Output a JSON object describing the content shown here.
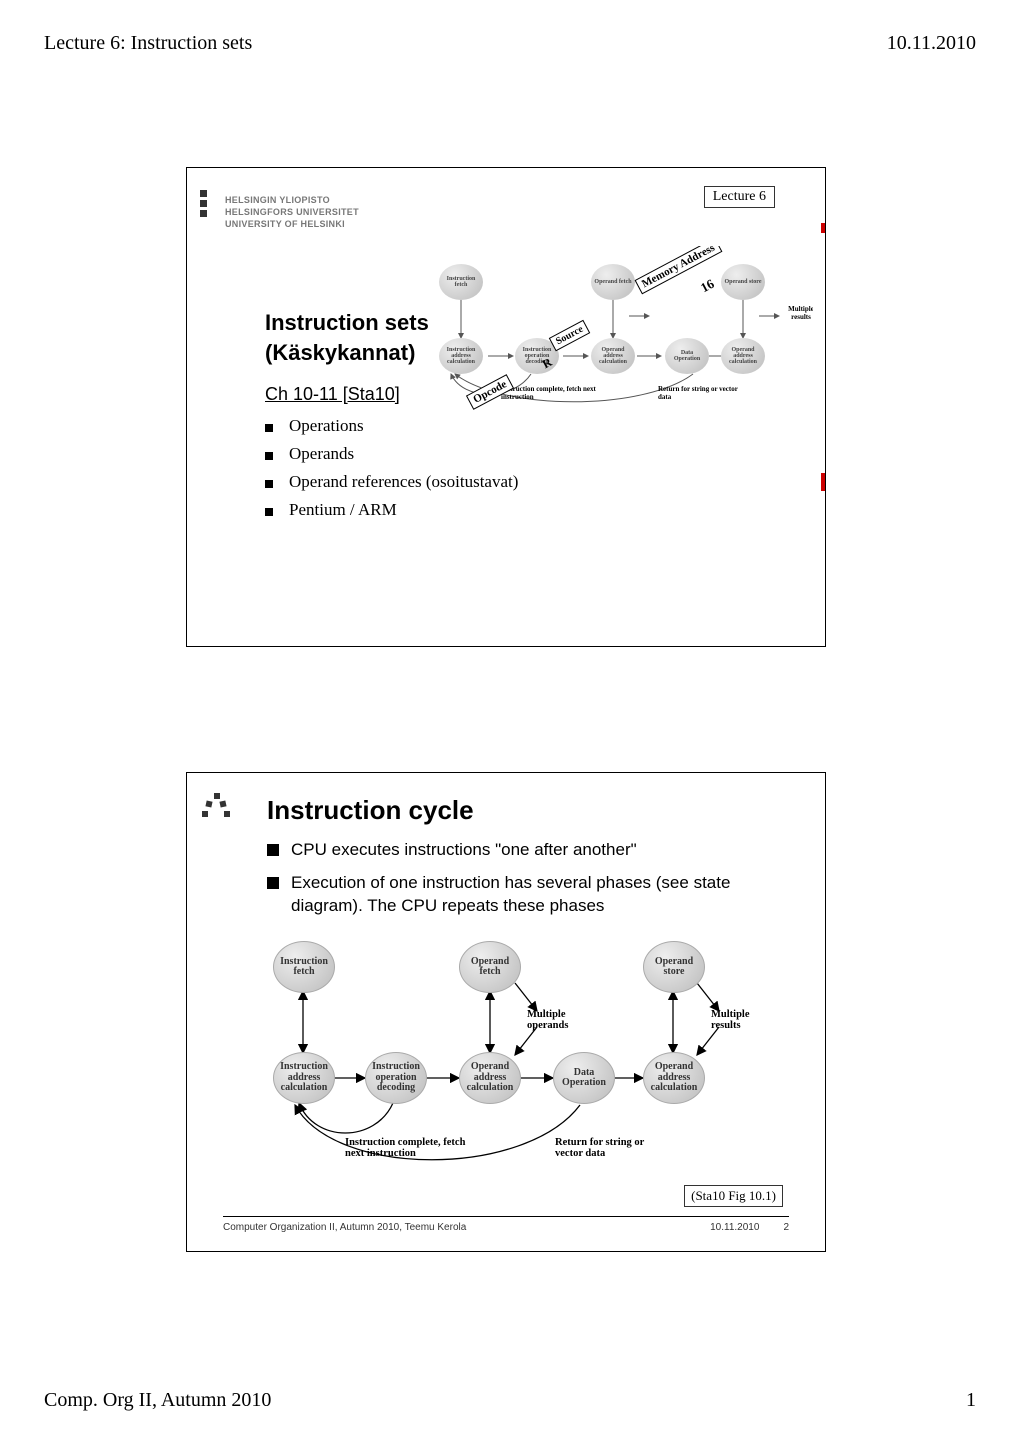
{
  "page": {
    "header_left": "Lecture 6: Instruction sets",
    "header_right": "10.11.2010",
    "footer_left": "Comp. Org II, Autumn 2010",
    "footer_right": "1"
  },
  "slide1": {
    "lecture_badge": "Lecture 6",
    "university": {
      "line1": "HELSINGIN YLIOPISTO",
      "line2": "HELSINGFORS UNIVERSITET",
      "line3": "UNIVERSITY OF HELSINKI"
    },
    "title_line1": "Instruction sets",
    "title_line2": "(Käskykannat)",
    "chapter": "Ch 10-11 [Sta10]",
    "items": [
      "Operations",
      "Operands",
      "Operand references (osoitustavat)",
      "Pentium / ARM"
    ],
    "overlay_labels": {
      "memory_address": "Memory Address",
      "sixteen": "16",
      "source": "Source",
      "r": "R",
      "opcode": "Opcode"
    },
    "diagram_nodes": {
      "instruction_fetch": "Instruction fetch",
      "operand_fetch": "Operand fetch",
      "operand_store": "Operand store",
      "multiple_results": "Multiple results",
      "instruction_address_calc": "Instruction address calculation",
      "instruction_op_decode": "Instruction operation decoding",
      "operand_address_calc_src": "Operand address calculation",
      "data_operation": "Data Operation",
      "operand_address_calc_dst": "Operand address calculation",
      "instruction_complete": "Instruction complete, fetch next instruction",
      "return_string": "Return for string or vector data"
    }
  },
  "slide2": {
    "title": "Instruction cycle",
    "bullets": [
      "CPU executes instructions \"one after another\"",
      "Execution of one instruction has several phases (see state diagram). The CPU repeats these phases"
    ],
    "diagram": {
      "nodes": {
        "instruction_fetch": {
          "l1": "Instruction",
          "l2": "fetch"
        },
        "operand_fetch": {
          "l1": "Operand",
          "l2": "fetch"
        },
        "operand_store": {
          "l1": "Operand",
          "l2": "store"
        },
        "instruction_address_calc": {
          "l1": "Instruction",
          "l2": "address",
          "l3": "calculation"
        },
        "instruction_op_decoding": {
          "l1": "Instruction",
          "l2": "operation",
          "l3": "decoding"
        },
        "operand_address_calc_src": {
          "l1": "Operand",
          "l2": "address",
          "l3": "calculation"
        },
        "data_operation": {
          "l1": "Data",
          "l2": "Operation"
        },
        "operand_address_calc_dst": {
          "l1": "Operand",
          "l2": "address",
          "l3": "calculation"
        }
      },
      "labels": {
        "multiple_operands": "Multiple operands",
        "multiple_results": "Multiple results",
        "instruction_complete": "Instruction complete, fetch next instruction",
        "return_string": "Return for string or vector data"
      }
    },
    "figure_caption": "(Sta10 Fig 10.1)",
    "footer": {
      "left": "Computer Organization II, Autumn 2010, Teemu Kerola",
      "date": "10.11.2010",
      "page": "2"
    }
  }
}
